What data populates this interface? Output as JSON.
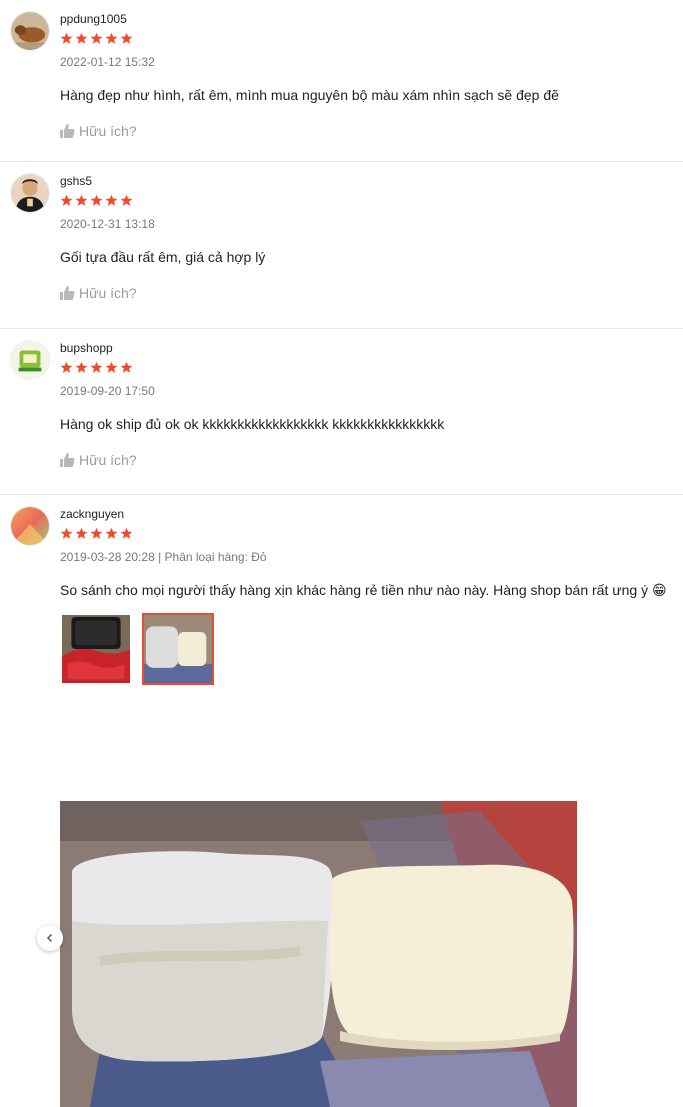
{
  "reviews": [
    {
      "username": "ppdung1005",
      "rating": 5,
      "meta": "2022-01-12 15:32",
      "content": "Hàng đẹp như hình, rất êm, mình mua nguyên bộ màu xám nhìn sạch sẽ đẹp đẽ",
      "helpful_label": "Hữu ích?"
    },
    {
      "username": "gshs5",
      "rating": 5,
      "meta": "2020-12-31 13:18",
      "content": "Gối tựa đầu rất êm, giá cả hợp lý",
      "helpful_label": "Hữu ích?"
    },
    {
      "username": "bupshopp",
      "rating": 5,
      "meta": "2019-09-20 17:50",
      "content": "Hàng ok ship đủ ok ok kkkkkkkkkkkkkkkkkk kkkkkkkkkkkkkkkk",
      "helpful_label": "Hữu ích?"
    },
    {
      "username": "zacknguyen",
      "rating": 5,
      "meta": "2019-03-28 20:28 | Phân loại hàng: Đỏ",
      "content": "So sánh cho mọi người thấy hàng xịn khác hàng rẻ tiền như nào này. Hàng shop bán rất ưng ý 😁",
      "thumbnails": [
        "thumbnail-pillow-bags",
        "thumbnail-pillow-comparison"
      ],
      "active_thumbnail": 1
    }
  ],
  "icons": {
    "star": "star-icon",
    "helpful": "thumbs-up-icon",
    "prev": "chevron-left-icon"
  },
  "colors": {
    "star": "#ee4d2d",
    "active_border": "#ee4d2d",
    "muted_text": "#8a8a8a"
  }
}
